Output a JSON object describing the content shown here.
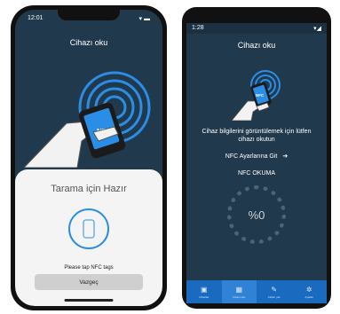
{
  "iphone": {
    "status_time": "12:01",
    "status_icons": "▾ ▬",
    "title": "Cihazı oku",
    "nfc_label": "NFC",
    "sheet": {
      "title": "Tarama için Hazır",
      "hint": "Please tap NFC tags",
      "cancel_label": "Vazgeç"
    }
  },
  "android": {
    "status_time": "1:28",
    "status_icons": "▾◢",
    "title": "Cihazı oku",
    "nfc_label": "NFC",
    "description": "Cihaz bilgilerini görüntülemek için lütfen cihazı okutun",
    "settings_link": "NFC Ayarlarına Git",
    "settings_arrow": "➔",
    "read_label": "NFC OKUMA",
    "progress_text": "%0",
    "tabs": [
      {
        "icon": "▣",
        "label": "Cihazlar",
        "icon_name": "devices-icon"
      },
      {
        "icon": "▦",
        "label": "Cihazı oku",
        "icon_name": "scan-icon"
      },
      {
        "icon": "✎",
        "label": "Cihazı yaz",
        "icon_name": "write-icon"
      },
      {
        "icon": "✲",
        "label": "Ayarlar",
        "icon_name": "gear-icon"
      }
    ],
    "active_tab_index": 1
  },
  "colors": {
    "background": "#21394c",
    "accent": "#2a8ee6",
    "tabbar": "#1a6bc0"
  }
}
